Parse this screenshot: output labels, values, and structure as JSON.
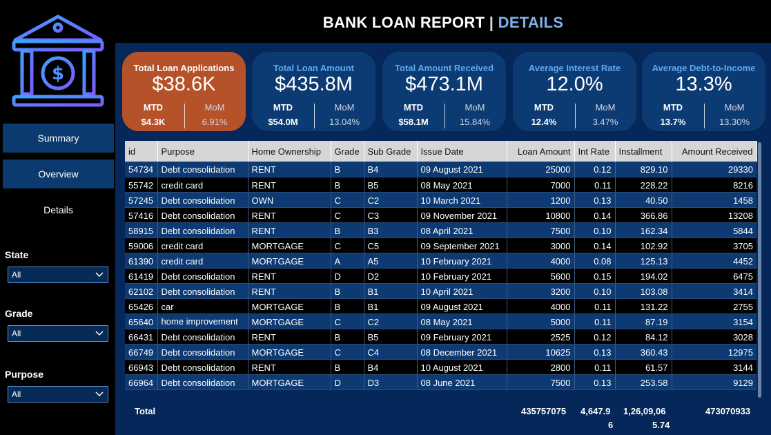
{
  "header": {
    "title_main": "BANK LOAN REPORT",
    "separator": "|",
    "title_accent": "DETAILS"
  },
  "sidebar": {
    "nav": [
      "Summary",
      "Overview",
      "Details"
    ],
    "filters": [
      {
        "label": "State",
        "value": "All"
      },
      {
        "label": "Grade",
        "value": "All"
      },
      {
        "label": "Purpose",
        "value": "All"
      }
    ]
  },
  "kpis": [
    {
      "title": "Total Loan Applications",
      "value": "$38.6K",
      "mtd_label": "MTD",
      "mtd": "$4.3K",
      "mom_label": "MoM",
      "mom": "6.91%"
    },
    {
      "title": "Total Loan Amount",
      "value": "$435.8M",
      "mtd_label": "MTD",
      "mtd": "$54.0M",
      "mom_label": "MoM",
      "mom": "13.04%"
    },
    {
      "title": "Total Amount Received",
      "value": "$473.1M",
      "mtd_label": "MTD",
      "mtd": "$58.1M",
      "mom_label": "MoM",
      "mom": "15.84%"
    },
    {
      "title": "Average Interest Rate",
      "value": "12.0%",
      "mtd_label": "MTD",
      "mtd": "12.4%",
      "mom_label": "MoM",
      "mom": "3.47%"
    },
    {
      "title": "Average Debt-to-Income",
      "value": "13.3%",
      "mtd_label": "MTD",
      "mtd": "13.7%",
      "mom_label": "MoM",
      "mom": "13.30%"
    }
  ],
  "table": {
    "columns": [
      "id",
      "Purpose",
      "Home Ownership",
      "Grade",
      "Sub Grade",
      "Issue Date",
      "Loan Amount",
      "Int Rate",
      "Installment",
      "Amount Received"
    ],
    "rows": [
      [
        "54734",
        "Debt consolidation",
        "RENT",
        "B",
        "B4",
        "09 August 2021",
        "25000",
        "0.12",
        "829.10",
        "29330"
      ],
      [
        "55742",
        "credit card",
        "RENT",
        "B",
        "B5",
        "08 May 2021",
        "7000",
        "0.11",
        "228.22",
        "8216"
      ],
      [
        "57245",
        "Debt consolidation",
        "OWN",
        "C",
        "C2",
        "10 March 2021",
        "1200",
        "0.13",
        "40.50",
        "1458"
      ],
      [
        "57416",
        "Debt consolidation",
        "RENT",
        "C",
        "C3",
        "09 November 2021",
        "10800",
        "0.14",
        "366.86",
        "13208"
      ],
      [
        "58915",
        "Debt consolidation",
        "RENT",
        "B",
        "B3",
        "08 April 2021",
        "7500",
        "0.10",
        "162.34",
        "5844"
      ],
      [
        "59006",
        "credit card",
        "MORTGAGE",
        "C",
        "C5",
        "09 September 2021",
        "3000",
        "0.14",
        "102.92",
        "3705"
      ],
      [
        "61390",
        "credit card",
        "MORTGAGE",
        "A",
        "A5",
        "10 February 2021",
        "4000",
        "0.08",
        "125.13",
        "4452"
      ],
      [
        "61419",
        "Debt consolidation",
        "RENT",
        "D",
        "D2",
        "10 February 2021",
        "5600",
        "0.15",
        "194.02",
        "6475"
      ],
      [
        "62102",
        "Debt consolidation",
        "RENT",
        "B",
        "B1",
        "10 April 2021",
        "3200",
        "0.10",
        "103.08",
        "3414"
      ],
      [
        "65426",
        "car",
        "MORTGAGE",
        "B",
        "B1",
        "09 August 2021",
        "4000",
        "0.11",
        "131.22",
        "2755"
      ],
      [
        "65640",
        "home improvement",
        "MORTGAGE",
        "C",
        "C2",
        "08 May 2021",
        "5000",
        "0.11",
        "87.19",
        "3154"
      ],
      [
        "66431",
        "Debt consolidation",
        "RENT",
        "B",
        "B5",
        "09 February 2021",
        "2525",
        "0.12",
        "84.12",
        "3028"
      ],
      [
        "66749",
        "Debt consolidation",
        "MORTGAGE",
        "C",
        "C4",
        "08 December 2021",
        "10625",
        "0.13",
        "360.43",
        "12975"
      ],
      [
        "66943",
        "Debt consolidation",
        "RENT",
        "B",
        "B4",
        "10 August 2021",
        "2800",
        "0.11",
        "61.57",
        "3144"
      ],
      [
        "66964",
        "Debt consolidation",
        "MORTGAGE",
        "D",
        "D3",
        "08 June 2021",
        "7500",
        "0.13",
        "253.58",
        "9129"
      ]
    ],
    "total": {
      "label": "Total",
      "loan_amount": "435757075",
      "int_rate_a": "4,647.9",
      "int_rate_b": "6",
      "installment_a": "1,26,09,06",
      "installment_b": "5.74",
      "amount_received": "473070933"
    }
  }
}
